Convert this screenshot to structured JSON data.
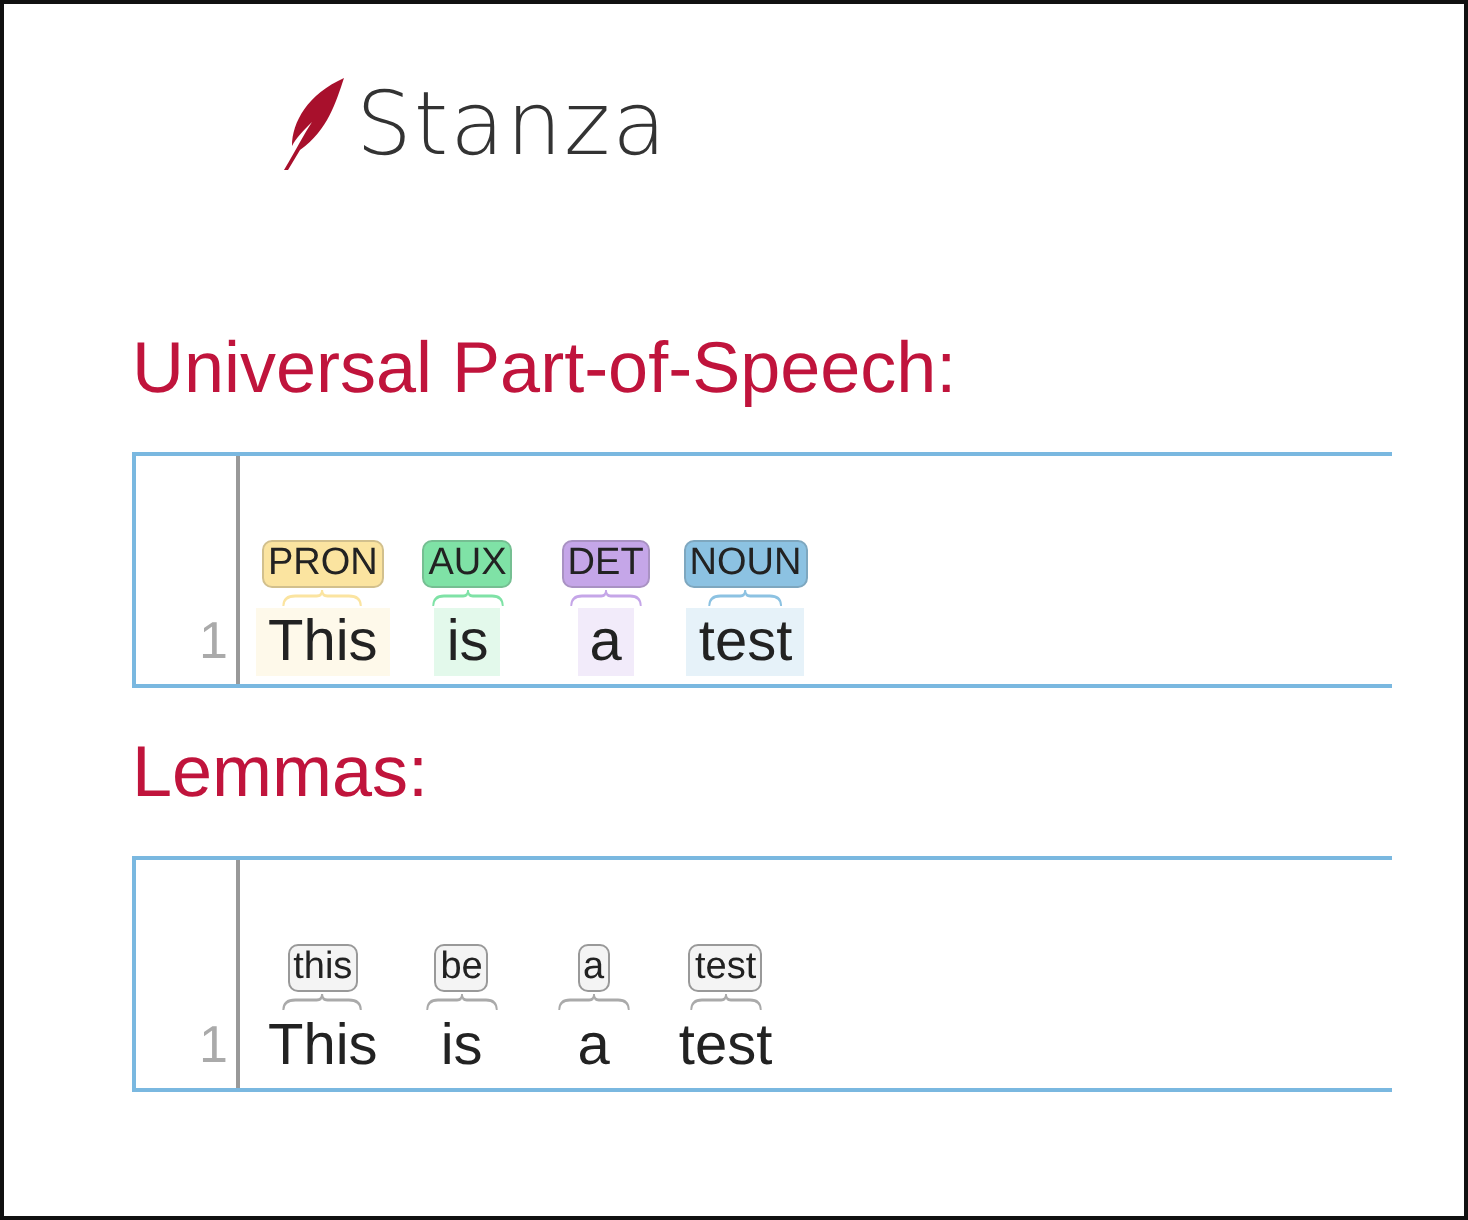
{
  "logo": {
    "text": "Stanza"
  },
  "sections": [
    {
      "title": "Universal Part-of-Speech:",
      "kind": "pos",
      "line_number": "1",
      "tokens": [
        {
          "word": "This",
          "tag": "PRON",
          "color": "#fbe4a0"
        },
        {
          "word": "is",
          "tag": "AUX",
          "color": "#7fe2a6"
        },
        {
          "word": "a",
          "tag": "DET",
          "color": "#c5a6e8"
        },
        {
          "word": "test",
          "tag": "NOUN",
          "color": "#8cc2e2"
        }
      ]
    },
    {
      "title": "Lemmas:",
      "kind": "lemma",
      "line_number": "1",
      "tokens": [
        {
          "word": "This",
          "tag": "this"
        },
        {
          "word": "is",
          "tag": "be"
        },
        {
          "word": "a",
          "tag": "a"
        },
        {
          "word": "test",
          "tag": "test"
        }
      ]
    }
  ]
}
